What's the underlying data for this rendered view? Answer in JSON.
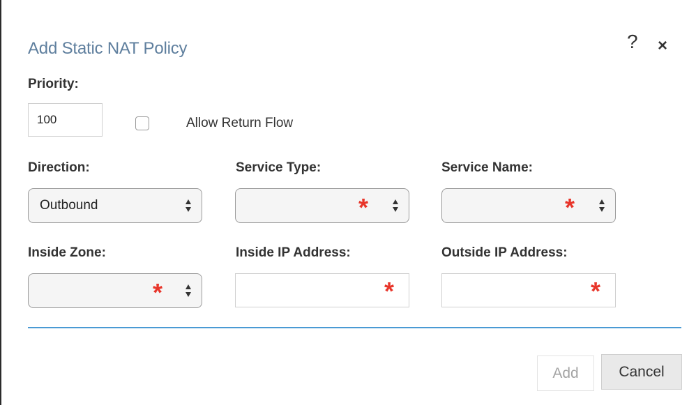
{
  "dialog": {
    "title": "Add Static NAT Policy",
    "help_glyph": "?",
    "close_glyph": "×"
  },
  "priority": {
    "label": "Priority:",
    "value": "100",
    "allow_return_flow": {
      "label": "Allow Return Flow",
      "checked": false
    }
  },
  "fields": {
    "direction": {
      "label": "Direction:",
      "value": "Outbound"
    },
    "service_type": {
      "label": "Service Type:",
      "value": ""
    },
    "service_name": {
      "label": "Service Name:",
      "value": ""
    },
    "inside_zone": {
      "label": "Inside Zone:",
      "value": ""
    },
    "inside_ip": {
      "label": "Inside IP Address:",
      "value": ""
    },
    "outside_ip": {
      "label": "Outside IP Address:",
      "value": ""
    }
  },
  "required_marker": "*",
  "buttons": {
    "add_label": "Add",
    "cancel_label": "Cancel"
  },
  "colors": {
    "title": "#5f7f9e",
    "required": "#e8352a",
    "divider": "#4a9ad4"
  }
}
